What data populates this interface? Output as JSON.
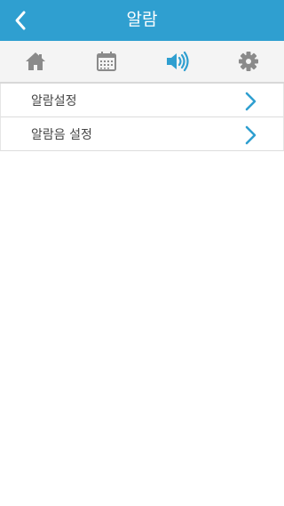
{
  "header": {
    "title": "알람",
    "back_icon": "chevron-left-icon",
    "background_color": "#2f9fd0"
  },
  "tabs": [
    {
      "icon": "home-icon",
      "active": false
    },
    {
      "icon": "calendar-icon",
      "active": false
    },
    {
      "icon": "speaker-icon",
      "active": true
    },
    {
      "icon": "gear-icon",
      "active": false
    }
  ],
  "colors": {
    "accent": "#2f9fd0",
    "inactive_icon": "#8a8a8a"
  },
  "menu": {
    "items": [
      {
        "label": "알람설정",
        "icon": "chevron-right-icon"
      },
      {
        "label": "알람음 설정",
        "icon": "chevron-right-icon"
      }
    ]
  }
}
